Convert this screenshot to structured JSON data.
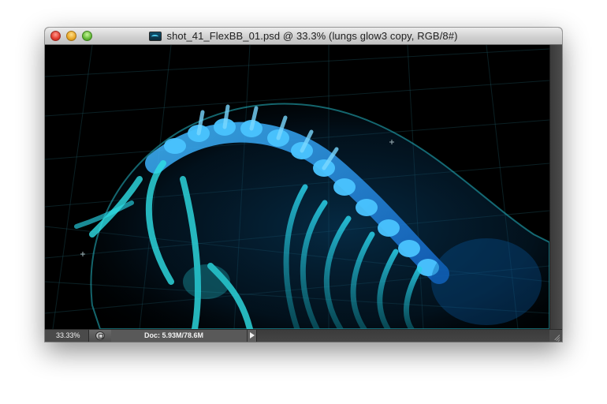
{
  "window": {
    "title": "shot_41_FlexBB_01.psd @ 33.3% (lungs glow3 copy, RGB/8#)",
    "doc_icon": "photoshop-document-icon",
    "controls": [
      "close-button",
      "minimize-button",
      "zoom-button"
    ]
  },
  "canvas": {
    "description_icon": "xray-skeleton-artwork",
    "background_color": "#000000",
    "accent_colors": [
      "#1e9cff",
      "#27d3e0",
      "#0a3b66"
    ]
  },
  "statusbar": {
    "zoom": "33.33%",
    "doc_size": "Doc: 5.93M/78.6M",
    "info_icon": "status-info-icon",
    "menu_arrow_icon": "status-menu-arrow-icon"
  }
}
